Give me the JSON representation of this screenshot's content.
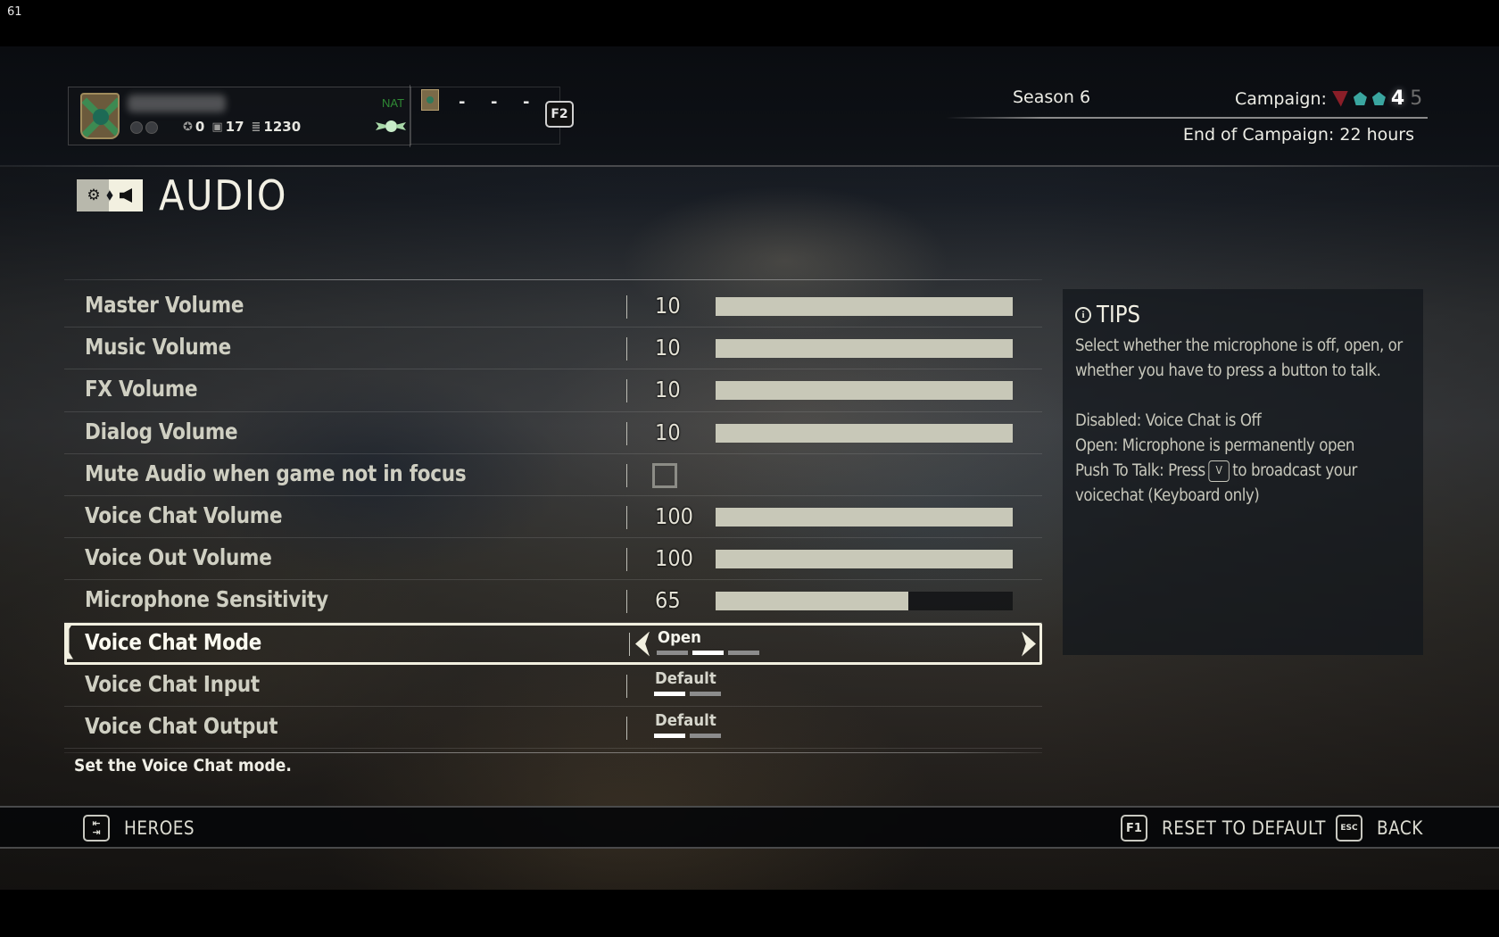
{
  "fps_counter": "61",
  "header": {
    "player": {
      "name_blurred": true,
      "stats": [
        {
          "icon": "reputation-icon",
          "glyph": "✪",
          "value": "0"
        },
        {
          "icon": "chest-icon",
          "glyph": "▣",
          "value": "17"
        },
        {
          "icon": "steel-icon",
          "glyph": "≣",
          "value": "1230"
        }
      ]
    },
    "faction_tag": "NAT",
    "party_slots": [
      "-",
      "-",
      "-"
    ],
    "party_key": "F2",
    "season": "Season 6",
    "campaign": {
      "label": "Campaign:",
      "current": "4",
      "next": "5"
    },
    "end_of_campaign": "End of Campaign: 22 hours"
  },
  "page": {
    "title": "AUDIO"
  },
  "settings": [
    {
      "label": "Master Volume",
      "type": "slider",
      "value": "10",
      "fill": 1.0
    },
    {
      "label": "Music Volume",
      "type": "slider",
      "value": "10",
      "fill": 1.0
    },
    {
      "label": "FX Volume",
      "type": "slider",
      "value": "10",
      "fill": 1.0
    },
    {
      "label": "Dialog Volume",
      "type": "slider",
      "value": "10",
      "fill": 1.0
    },
    {
      "label": "Mute Audio when game not in focus",
      "type": "checkbox",
      "checked": false
    },
    {
      "label": "Voice Chat Volume",
      "type": "slider",
      "value": "100",
      "fill": 1.0
    },
    {
      "label": "Voice Out Volume",
      "type": "slider",
      "value": "100",
      "fill": 1.0
    },
    {
      "label": "Microphone Sensitivity",
      "type": "slider",
      "value": "65",
      "fill": 0.65
    },
    {
      "label": "Voice Chat Mode",
      "type": "choice",
      "value": "Open",
      "option_count": 3,
      "selected_index": 1,
      "selected": true
    },
    {
      "label": "Voice Chat Input",
      "type": "choice",
      "value": "Default",
      "option_count": 2,
      "selected_index": 0
    },
    {
      "label": "Voice Chat Output",
      "type": "choice",
      "value": "Default",
      "option_count": 2,
      "selected_index": 0
    }
  ],
  "description": "Set the Voice Chat mode.",
  "tips": {
    "title": "TIPS",
    "intro": "Select whether the microphone is off, open, or whether you have to press a button to talk.",
    "line_disabled": "Disabled: Voice Chat is Off",
    "line_open": "Open: Microphone is permanently open",
    "line_ptt_before": "Push To Talk: Press",
    "line_ptt_key": "V",
    "line_ptt_after": "to broadcast your voicechat (Keyboard only)"
  },
  "footer": {
    "heroes": {
      "key": "⇤⇥",
      "label": "HEROES"
    },
    "reset": {
      "key": "F1",
      "label": "RESET TO DEFAULT"
    },
    "back": {
      "key": "ESC",
      "label": "BACK"
    }
  }
}
